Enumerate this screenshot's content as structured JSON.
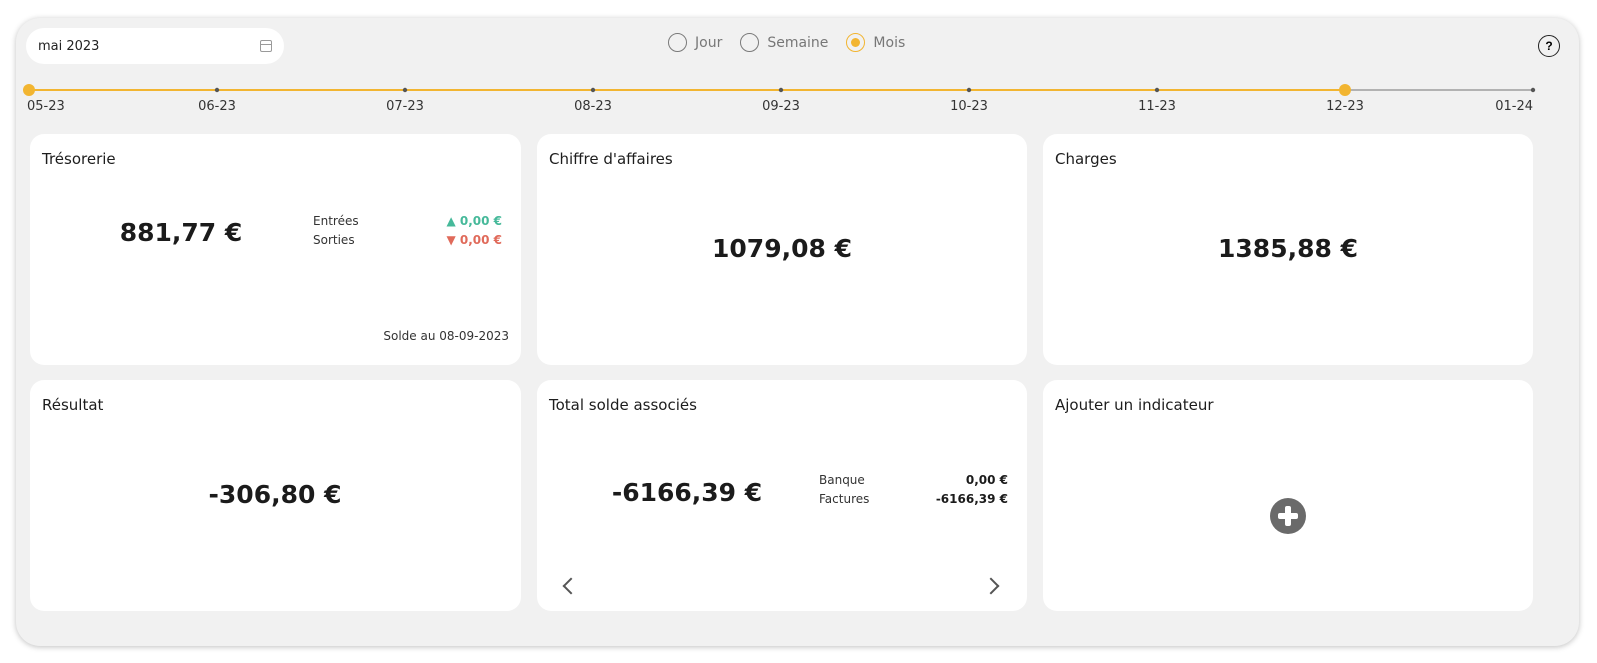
{
  "date_picker": {
    "value": "mai 2023",
    "icon": "calendar-icon"
  },
  "period": {
    "options": [
      {
        "label": "Jour",
        "checked": false
      },
      {
        "label": "Semaine",
        "checked": false
      },
      {
        "label": "Mois",
        "checked": true
      }
    ]
  },
  "help": {
    "label": "?"
  },
  "timeline": {
    "labels": [
      "05-23",
      "06-23",
      "07-23",
      "08-23",
      "09-23",
      "10-23",
      "11-23",
      "12-23",
      "01-24"
    ],
    "range_start": "05-23",
    "range_end": "12-23",
    "accent_color": "#f2b531",
    "inactive_color": "#9e9e9e"
  },
  "cards": {
    "tresorerie": {
      "title": "Trésorerie",
      "amount": "881,77 €",
      "in_label": "Entrées",
      "in_value": "▲ 0,00 €",
      "out_label": "Sorties",
      "out_value": "▼ 0,00 €",
      "footer": "Solde au 08-09-2023"
    },
    "chiffre": {
      "title": "Chiffre d'affaires",
      "amount": "1079,08 €"
    },
    "charges": {
      "title": "Charges",
      "amount": "1385,88 €"
    },
    "resultat": {
      "title": "Résultat",
      "amount": "-306,80 €"
    },
    "associes": {
      "title": "Total solde associés",
      "amount": "-6166,39 €",
      "bank_label": "Banque",
      "bank_value": "0,00 €",
      "invoices_label": "Factures",
      "invoices_value": "-6166,39 €"
    },
    "ajouter": {
      "title": "Ajouter un indicateur",
      "icon": "plus-circle-icon"
    }
  },
  "colors": {
    "positive": "#46b99a",
    "negative": "#e06a5a",
    "accent": "#f2b531"
  }
}
